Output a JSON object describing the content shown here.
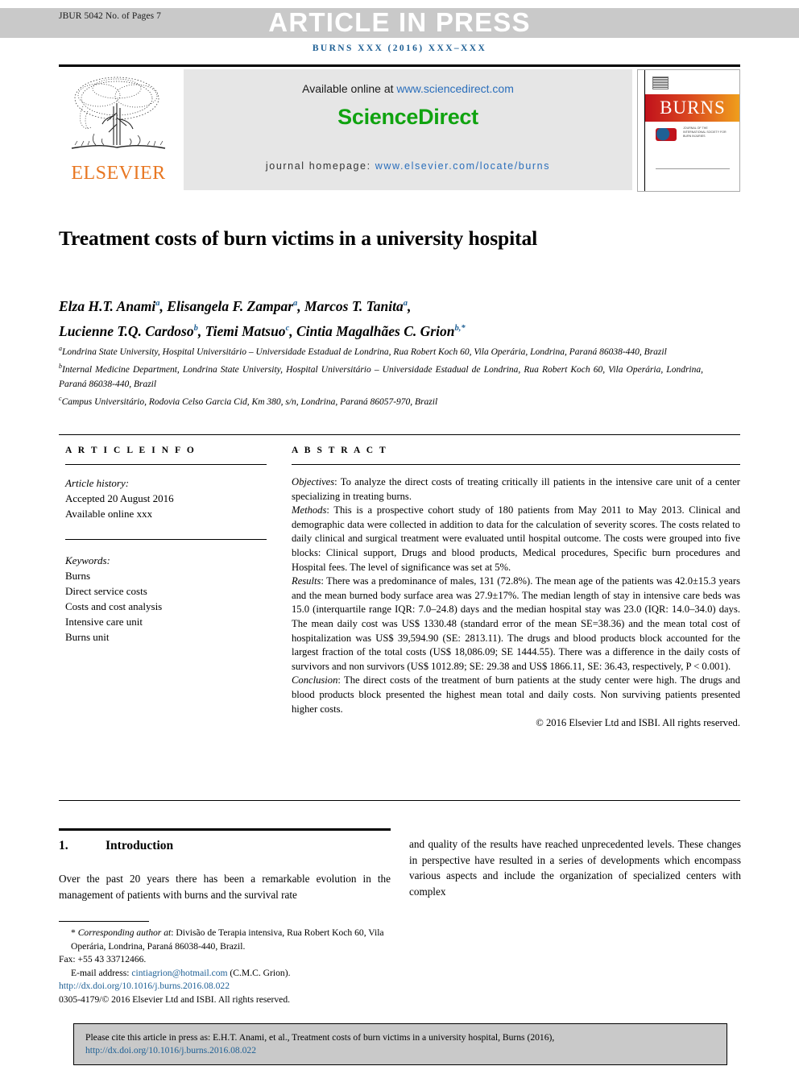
{
  "header": {
    "stamp": "JBUR 5042 No. of Pages 7",
    "banner": "ARTICLE IN PRESS",
    "journal_ref": "BURNS XXX (2016) XXX–XXX"
  },
  "masthead": {
    "publisher": "ELSEVIER",
    "available_prefix": "Available online at ",
    "available_url": "www.sciencedirect.com",
    "sciencedirect_logo": "ScienceDirect",
    "homepage_label": "journal homepage: ",
    "homepage_url": "www.elsevier.com/locate/burns",
    "cover_title": "BURNS",
    "cover_society": "JOURNAL OF THE INTERNATIONAL SOCIETY FOR BURN INJURIES"
  },
  "article": {
    "title": "Treatment costs of burn victims in a university hospital",
    "authors_line1": "Elza H.T. Anami",
    "authors": [
      {
        "name": "Elza H.T. Anami",
        "sup": "a"
      },
      {
        "name": "Elisangela F. Zampar",
        "sup": "a"
      },
      {
        "name": "Marcos T. Tanita",
        "sup": "a"
      },
      {
        "name": "Lucienne T.Q. Cardoso",
        "sup": "b"
      },
      {
        "name": "Tiemi Matsuo",
        "sup": "c"
      },
      {
        "name": "Cintia Magalhães C. Grion",
        "sup": "b,*"
      }
    ],
    "affiliations": [
      {
        "sup": "a",
        "text": "Londrina State University, Hospital Universitário – Universidade Estadual de Londrina, Rua Robert Koch 60, Vila Operária, Londrina, Paraná 86038-440, Brazil"
      },
      {
        "sup": "b",
        "text": "Internal Medicine Department, Londrina State University, Hospital Universitário – Universidade Estadual de Londrina, Rua Robert Koch 60, Vila Operária, Londrina, Paraná 86038-440, Brazil"
      },
      {
        "sup": "c",
        "text": "Campus Universitário, Rodovia Celso Garcia Cid, Km 380, s/n, Londrina, Paraná 86057-970, Brazil"
      }
    ]
  },
  "article_info": {
    "heading": "A R T I C L E  I N F O",
    "history_label": "Article history:",
    "history_lines": [
      "Accepted 20 August 2016",
      "Available online xxx"
    ],
    "keywords_label": "Keywords:",
    "keywords": [
      "Burns",
      "Direct service costs",
      "Costs and cost analysis",
      "Intensive care unit",
      "Burns unit"
    ]
  },
  "abstract": {
    "heading": "A B S T R A C T",
    "sections": [
      {
        "label": "Objectives",
        "text": ": To analyze the direct costs of treating critically ill patients in the intensive care unit of a center specializing in treating burns."
      },
      {
        "label": "Methods",
        "text": ": This is a prospective cohort study of 180 patients from May 2011 to May 2013. Clinical and demographic data were collected in addition to data for the calculation of severity scores. The costs related to daily clinical and surgical treatment were evaluated until hospital outcome. The costs were grouped into five blocks: Clinical support, Drugs and blood products, Medical procedures, Specific burn procedures and Hospital fees. The level of significance was set at 5%."
      },
      {
        "label": "Results",
        "text": ": There was a predominance of males, 131 (72.8%). The mean age of the patients was 42.0±15.3 years and the mean burned body surface area was 27.9±17%. The median length of stay in intensive care beds was 15.0 (interquartile range IQR: 7.0–24.8) days and the median hospital stay was 23.0 (IQR: 14.0–34.0) days. The mean daily cost was US$ 1330.48 (standard error of the mean SE=38.36) and the mean total cost of hospitalization was US$ 39,594.90 (SE: 2813.11). The drugs and blood products block accounted for the largest fraction of the total costs (US$ 18,086.09; SE 1444.55). There was a difference in the daily costs of survivors and non survivors (US$ 1012.89; SE: 29.38 and US$ 1866.11, SE: 36.43, respectively, P < 0.001)."
      },
      {
        "label": "Conclusion",
        "text": ": The direct costs of the treatment of burn patients at the study center were high. The drugs and blood products block presented the highest mean total and daily costs. Non surviving patients presented higher costs."
      }
    ],
    "copyright": "© 2016 Elsevier Ltd and ISBI. All rights reserved."
  },
  "body": {
    "section_number": "1.",
    "section_title": "Introduction",
    "left_paragraph": "Over the past 20 years there has been a remarkable evolution in the management of patients with burns and the survival rate",
    "right_paragraph": "and quality of the results have reached unprecedented levels. These changes in perspective have resulted in a series of developments which encompass various aspects and include the organization of specialized centers with complex"
  },
  "footnotes": {
    "corresponding_marker": "*",
    "corresponding_label": "Corresponding author at",
    "corresponding_text": ": Divisão de Terapia intensiva, Rua Robert Koch 60, Vila Operária, Londrina, Paraná 86038-440, Brazil.",
    "fax": "Fax: +55 43 33712466.",
    "email_label": "E-mail address: ",
    "email": "cintiagrion@hotmail.com",
    "email_suffix": " (C.M.C.  Grion).",
    "doi_url": "http://dx.doi.org/10.1016/j.burns.2016.08.022",
    "issn_line": "0305-4179/© 2016 Elsevier Ltd and ISBI. All rights reserved."
  },
  "cite_box": {
    "text": "Please cite this article in press as: E.H.T. Anami, et al., Treatment costs of burn victims in a university hospital, Burns (2016), ",
    "link": "http://dx.doi.org/10.1016/j.burns.2016.08.022"
  },
  "colors": {
    "banner_gray": "#c9c9c9",
    "link_blue": "#1f6095",
    "sd_green": "#10a310",
    "elsevier_orange": "#e87722",
    "panel_gray": "#e6e6e6"
  }
}
